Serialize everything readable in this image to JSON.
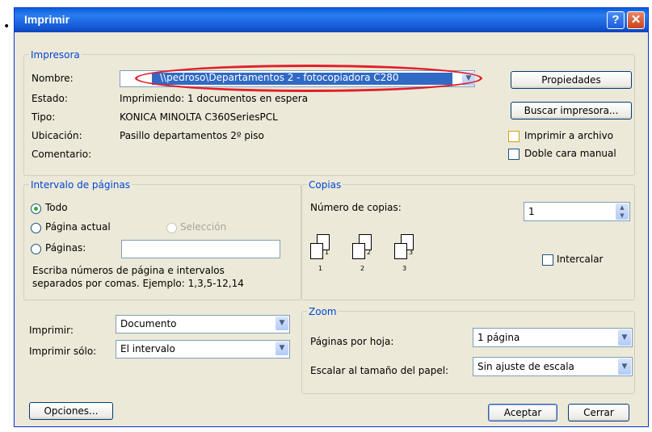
{
  "bullet": "•",
  "dialog": {
    "title": "Imprimir",
    "help_label": "?",
    "close_label": "✕"
  },
  "printer": {
    "legend": "Impresora",
    "name_label": "Nombre:",
    "name_value": "\\\\pedroso\\Departamentos 2 - fotocopiadora C280",
    "status_label": "Estado:",
    "status_value": "Imprimiendo: 1 documentos en espera",
    "type_label": "Tipo:",
    "type_value": "KONICA MINOLTA C360SeriesPCL",
    "location_label": "Ubicación:",
    "location_value": "Pasillo departamentos 2º piso",
    "comment_label": "Comentario:",
    "properties_button": "Propiedades",
    "find_button": "Buscar impresora...",
    "print_to_file": "Imprimir a archivo",
    "manual_duplex": "Doble cara manual",
    "highlight_color": "#e0202a"
  },
  "page_range": {
    "legend": "Intervalo de páginas",
    "all": "Todo",
    "current": "Página actual",
    "selection": "Selección",
    "pages": "Páginas:",
    "pages_value": "",
    "hint_line1": "Escriba números de página e intervalos",
    "hint_line2": "separados por comas. Ejemplo: 1,3,5-12,14"
  },
  "copies": {
    "legend": "Copias",
    "count_label": "Número de copias:",
    "count_value": "1",
    "collate": "Intercalar",
    "page_labels": [
      "1",
      "1",
      "2",
      "2",
      "3",
      "3"
    ]
  },
  "print_what": {
    "label": "Imprimir:",
    "value": "Documento",
    "only_label": "Imprimir sólo:",
    "only_value": "El intervalo"
  },
  "zoom": {
    "legend": "Zoom",
    "pages_per_sheet_label": "Páginas por hoja:",
    "pages_per_sheet_value": "1 página",
    "scale_label": "Escalar al tamaño del papel:",
    "scale_value": "Sin ajuste de escala"
  },
  "footer": {
    "options": "Opciones...",
    "ok": "Aceptar",
    "close": "Cerrar"
  }
}
